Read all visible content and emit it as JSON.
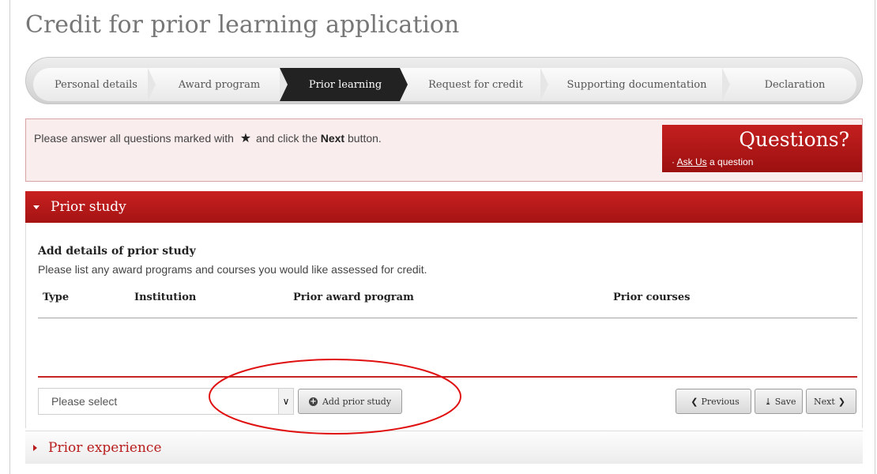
{
  "page": {
    "title": "Credit for prior learning application"
  },
  "steps": [
    {
      "label": "Personal details",
      "active": false
    },
    {
      "label": "Award program",
      "active": false
    },
    {
      "label": "Prior learning",
      "active": true
    },
    {
      "label": "Request for credit",
      "active": false
    },
    {
      "label": "Supporting documentation",
      "active": false
    },
    {
      "label": "Declaration",
      "active": false
    }
  ],
  "notice": {
    "text_before": "Please answer all questions marked with",
    "text_middle": "and click the",
    "next_word": "Next",
    "text_after": "button."
  },
  "questions": {
    "title": "Questions?",
    "ask_link": "Ask Us",
    "ask_suffix": "a question"
  },
  "prior_study": {
    "section_title": "Prior study",
    "subtitle": "Add details of prior study",
    "description": "Please list any award programs and courses you would like assessed for credit.",
    "columns": [
      "Type",
      "Institution",
      "Prior award program",
      "Prior courses"
    ],
    "select": {
      "value": "Please select"
    },
    "add_button": "Add prior study"
  },
  "nav": {
    "previous": "Previous",
    "save": "Save",
    "next": "Next"
  },
  "prior_experience": {
    "section_title": "Prior experience"
  },
  "colors": {
    "brand_red": "#b81c1c",
    "annotation_red": "#e01010"
  },
  "icons": {
    "required": "star-icon",
    "add": "plus-circle-icon",
    "previous": "chevron-left-icon",
    "save": "save-icon",
    "next": "chevron-right-icon"
  }
}
